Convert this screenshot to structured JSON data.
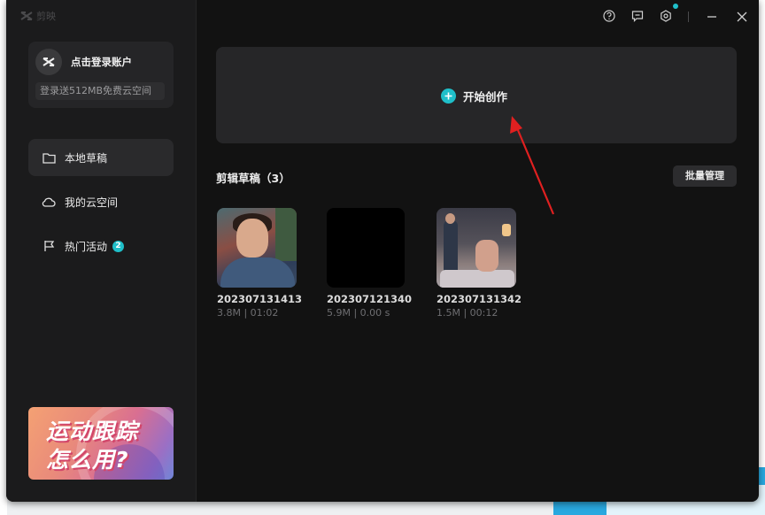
{
  "app": {
    "name": "剪映"
  },
  "login": {
    "label": "点击登录账户",
    "promo": "登录送512MB免费云空间"
  },
  "nav": {
    "items": [
      {
        "label": "本地草稿",
        "icon": "folder-icon",
        "active": true
      },
      {
        "label": "我的云空间",
        "icon": "cloud-icon",
        "active": false
      },
      {
        "label": "热门活动",
        "icon": "flag-icon",
        "active": false,
        "badge": "2"
      }
    ]
  },
  "banner": {
    "line1": "运动跟踪",
    "line2": "怎么用?"
  },
  "toolbar": {
    "icons": [
      "help-icon",
      "feedback-icon",
      "settings-icon",
      "minimize-icon",
      "close-icon"
    ]
  },
  "create": {
    "label": "开始创作"
  },
  "drafts": {
    "title": "剪辑草稿（3）",
    "batch_label": "批量管理",
    "items": [
      {
        "name": "202307131413",
        "meta": "3.8M | 01:02"
      },
      {
        "name": "202307121340",
        "meta": "5.9M | 0.00 s"
      },
      {
        "name": "202307131342",
        "meta": "1.5M | 00:12"
      }
    ]
  },
  "colors": {
    "accent": "#1fbfc9",
    "annotation_arrow": "#e02020",
    "window_bg": "#121212",
    "sidebar_bg": "#1b1b1c"
  }
}
